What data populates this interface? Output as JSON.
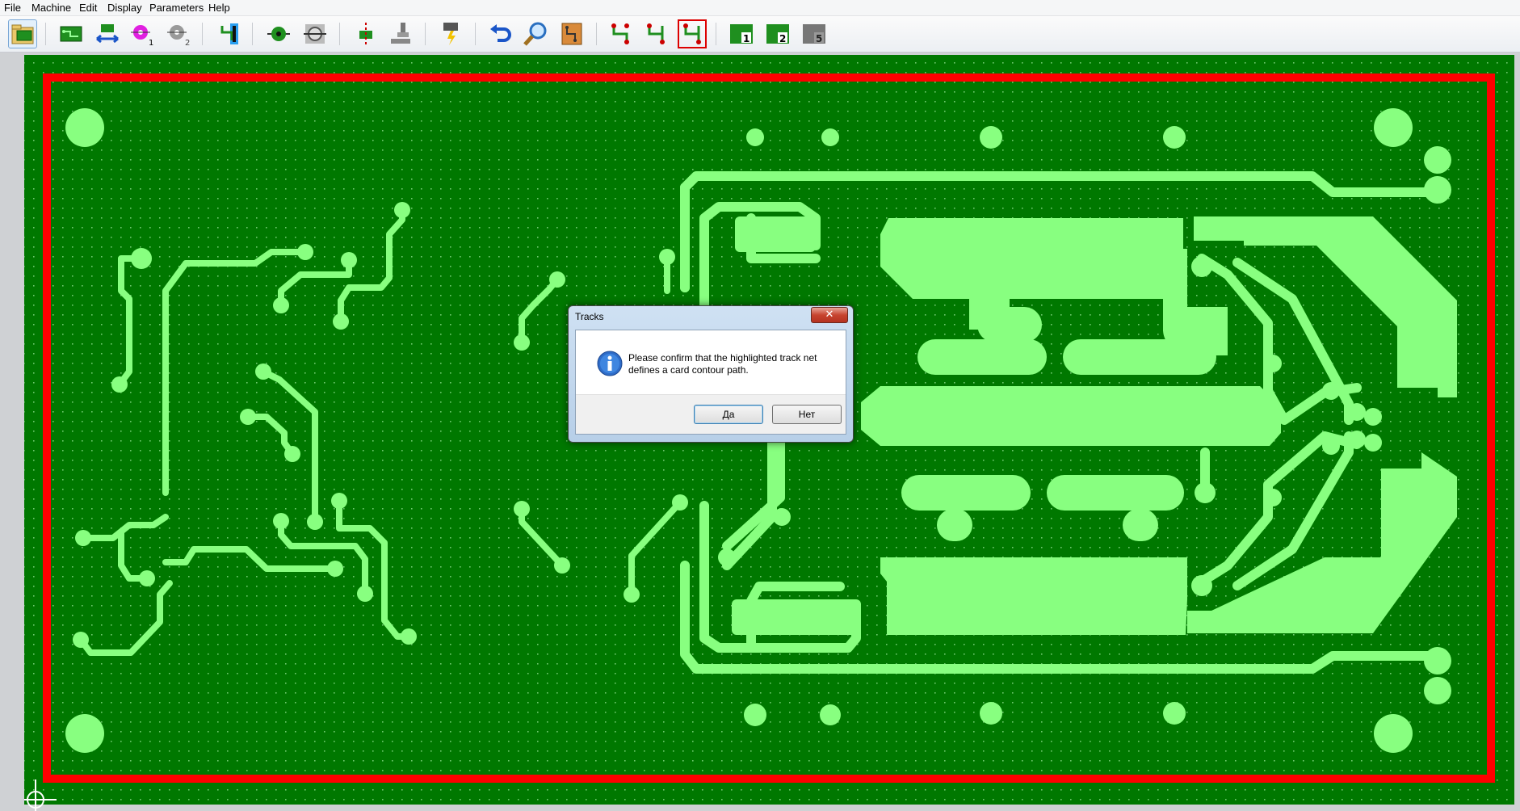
{
  "menu": {
    "file": "File",
    "machine": "Machine",
    "edit": "Edit",
    "display": "Display",
    "parameters": "Parameters",
    "help": "Help"
  },
  "toolbar": {
    "badges": {
      "hole1": "1",
      "hole2": "2",
      "layer1": "1",
      "layer2": "2",
      "layer5": "5"
    }
  },
  "dialog": {
    "title": "Tracks",
    "close_glyph": "✕",
    "message": "Please confirm that the highlighted track net defines a card contour path.",
    "yes_label": "Да",
    "no_label": "Нет",
    "icon": "info-icon"
  },
  "colors": {
    "board_green": "#007800",
    "track_green": "#88ff80",
    "contour_red": "#ff0000",
    "grid_dot": "#7fcf7f"
  }
}
